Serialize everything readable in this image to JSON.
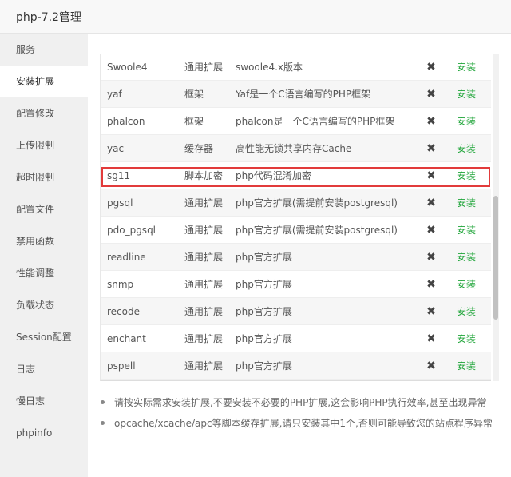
{
  "window": {
    "title": "php-7.2管理"
  },
  "sidebar": {
    "items": [
      {
        "label": "服务"
      },
      {
        "label": "安装扩展"
      },
      {
        "label": "配置修改"
      },
      {
        "label": "上传限制"
      },
      {
        "label": "超时限制"
      },
      {
        "label": "配置文件"
      },
      {
        "label": "禁用函数"
      },
      {
        "label": "性能调整"
      },
      {
        "label": "负载状态"
      },
      {
        "label": "Session配置"
      },
      {
        "label": "日志"
      },
      {
        "label": "慢日志"
      },
      {
        "label": "phpinfo"
      }
    ]
  },
  "extensions": {
    "rows": [
      {
        "name": "Swoole4",
        "type": "通用扩展",
        "desc": "swoole4.x版本",
        "status_icon": "✖",
        "action": "安装"
      },
      {
        "name": "yaf",
        "type": "框架",
        "desc": "Yaf是一个C语言编写的PHP框架",
        "status_icon": "✖",
        "action": "安装"
      },
      {
        "name": "phalcon",
        "type": "框架",
        "desc": "phalcon是一个C语言编写的PHP框架",
        "status_icon": "✖",
        "action": "安装"
      },
      {
        "name": "yac",
        "type": "缓存器",
        "desc": "高性能无锁共享内存Cache",
        "status_icon": "✖",
        "action": "安装"
      },
      {
        "name": "sg11",
        "type": "脚本加密",
        "desc": "php代码混淆加密",
        "status_icon": "✖",
        "action": "安装"
      },
      {
        "name": "pgsql",
        "type": "通用扩展",
        "desc": "php官方扩展(需提前安装postgresql)",
        "status_icon": "✖",
        "action": "安装"
      },
      {
        "name": "pdo_pgsql",
        "type": "通用扩展",
        "desc": "php官方扩展(需提前安装postgresql)",
        "status_icon": "✖",
        "action": "安装"
      },
      {
        "name": "readline",
        "type": "通用扩展",
        "desc": "php官方扩展",
        "status_icon": "✖",
        "action": "安装"
      },
      {
        "name": "snmp",
        "type": "通用扩展",
        "desc": "php官方扩展",
        "status_icon": "✖",
        "action": "安装"
      },
      {
        "name": "recode",
        "type": "通用扩展",
        "desc": "php官方扩展",
        "status_icon": "✖",
        "action": "安装"
      },
      {
        "name": "enchant",
        "type": "通用扩展",
        "desc": "php官方扩展",
        "status_icon": "✖",
        "action": "安装"
      },
      {
        "name": "pspell",
        "type": "通用扩展",
        "desc": "php官方扩展",
        "status_icon": "✖",
        "action": "安装"
      }
    ]
  },
  "notes": [
    "请按实际需求安装扩展,不要安装不必要的PHP扩展,这会影响PHP执行效率,甚至出现异常",
    "opcache/xcache/apc等脚本缓存扩展,请只安装其中1个,否则可能导致您的站点程序异常"
  ],
  "colors": {
    "install": "#20a53a",
    "highlight": "#e23b3b",
    "sidebar_bg": "#f0f0f0"
  }
}
